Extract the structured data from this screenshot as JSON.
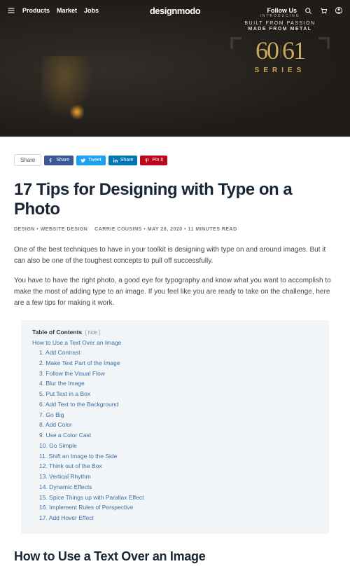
{
  "nav": {
    "links": [
      "Products",
      "Market",
      "Jobs"
    ],
    "logo": "designmodo",
    "follow": "Follow Us"
  },
  "hero": {
    "introducing": "INTRODUCING",
    "line1": "BUILT FROM PASSION",
    "line2": "MADE FROM METAL",
    "num1": "60",
    "num2": "61",
    "series": "SERIES"
  },
  "share": {
    "label": "Share",
    "fb": "Share",
    "tw": "Tweet",
    "li": "Share",
    "pi": "Pin it"
  },
  "article": {
    "title": "17 Tips for Designing with Type on a Photo",
    "cat1": "DESIGN",
    "cat2": "WEBSITE DESIGN",
    "author": "CARRIE COUSINS",
    "date": "MAY 28, 2020",
    "readtime": "11 MINUTES READ",
    "p1": "One of the best techniques to have in your toolkit is designing with type on and around images. But it can also be one of the toughest concepts to pull off successfully.",
    "p2": "You have to have the right photo, a good eye for typography and know what you want to accomplish to make the most of adding type to an image. If you feel like you are ready to take on the challenge, here are a few tips for making it work.",
    "h2": "How to Use a Text Over an Image"
  },
  "toc": {
    "header": "Table of Contents",
    "hide": "[ hide ]",
    "h2": "How to Use a Text Over an Image",
    "items": [
      "1. Add Contrast",
      "2. Make Text Part of the Image",
      "3. Follow the Visual Flow",
      "4. Blur the Image",
      "5. Put Text in a Box",
      "6. Add Text to the Background",
      "7. Go Big",
      "8. Add Color",
      "9. Use a Color Cast",
      "10. Go Simple",
      "11. Shift an Image to the Side",
      "12. Think out of the Box",
      "13. Vertical Rhythm",
      "14. Dynamic Effects",
      "15. Spice Things up with Parallax Effect",
      "16. Implement Rules of Perspective",
      "17. Add Hover Effect"
    ]
  }
}
